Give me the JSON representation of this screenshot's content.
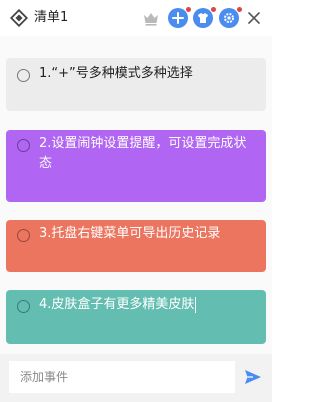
{
  "app": {
    "title": "清单1"
  },
  "toolbar": {
    "add_has_notification": true,
    "skin_has_notification": true,
    "settings_has_notification": true
  },
  "tasks": [
    {
      "text": "1.“+”号多种模式多种选择",
      "color": "#ececec",
      "checked": false
    },
    {
      "text": "2.设置闹钟设置提醒，可设置完成状态",
      "color": "#b066f2",
      "checked": false
    },
    {
      "text": "3.托盘右键菜单可导出历史记录",
      "color": "#ec7560",
      "checked": false
    },
    {
      "text": "4.皮肤盒子有更多精美皮肤",
      "color": "#63beb1",
      "checked": false
    }
  ],
  "input": {
    "placeholder": "添加事件",
    "value": ""
  },
  "colors": {
    "accent": "#4a8cf0",
    "notification": "#e04545"
  },
  "icons": [
    "app-logo-icon",
    "crown-icon",
    "plus-icon",
    "shirt-icon",
    "gear-icon",
    "close-icon",
    "send-icon"
  ]
}
